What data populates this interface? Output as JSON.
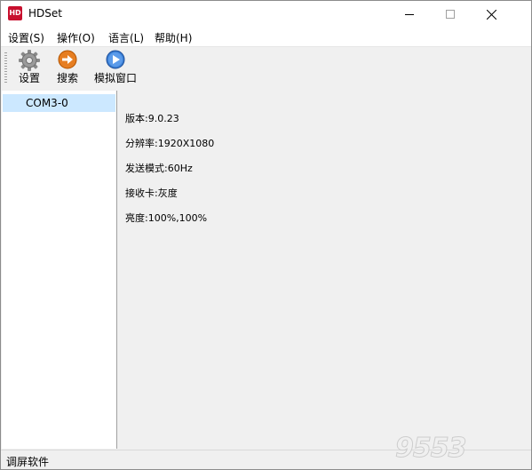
{
  "window": {
    "title": "HDSet",
    "app_icon_text": "HD",
    "controls": {
      "minimize": "minimize",
      "maximize": "maximize",
      "close": "close"
    }
  },
  "menu": [
    {
      "label": "设置(S)"
    },
    {
      "label": "操作(O)"
    },
    {
      "label": "语言(L)"
    },
    {
      "label": "帮助(H)"
    }
  ],
  "toolbar": [
    {
      "label": "设置",
      "icon": "gear-icon"
    },
    {
      "label": "搜索",
      "icon": "arrow-right-icon"
    },
    {
      "label": "模拟窗口",
      "icon": "play-icon"
    }
  ],
  "tree": {
    "items": [
      {
        "label": "COM3-0",
        "selected": true
      }
    ]
  },
  "info": {
    "version": "版本:9.0.23",
    "resolution": "分辨率:1920X1080",
    "send_mode": "发送模式:60Hz",
    "receiver": "接收卡:灰度",
    "brightness": "亮度:100%,100%"
  },
  "status": {
    "text": "调屏软件"
  },
  "watermark": {
    "text": "9553"
  },
  "colors": {
    "selection": "#cce8ff",
    "app_icon": "#c8102e",
    "chrome": "#f0f0f0"
  }
}
